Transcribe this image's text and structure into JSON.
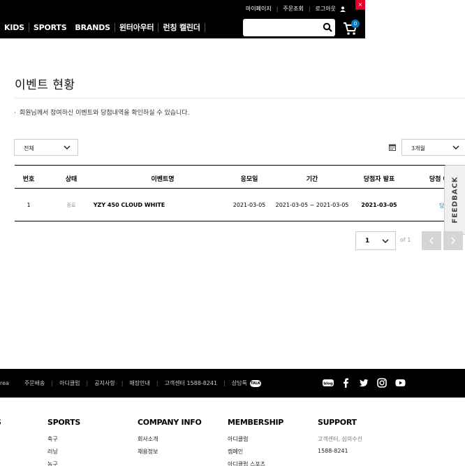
{
  "header": {
    "utility": [
      "마이페이지",
      "주문조회",
      "로그아웃"
    ],
    "close_badge": "×",
    "nav": [
      {
        "label": "KIDS"
      },
      {
        "label": "SPORTS"
      },
      {
        "label": "BRANDS"
      },
      {
        "label": "윈터아우터"
      },
      {
        "label": "런칭 캘린더"
      }
    ],
    "cart_count": "0"
  },
  "main": {
    "title": "이벤트 현황",
    "notice": "회원님께서 참여하신 이벤트와 당첨내역을 확인하실 수 있습니다.",
    "filter_type": "전체",
    "filter_period": "3개월",
    "table": {
      "headers": [
        "번호",
        "상태",
        "이벤트명",
        "응모일",
        "기간",
        "당첨자 발표",
        "당첨 여부"
      ],
      "rows": [
        {
          "no": "1",
          "status": "종료",
          "name": "YZY 450 CLOUD WHITE",
          "applied": "2021-03-05",
          "period": "2021-03-05 ~ 2021-03-05",
          "announce": "2021-03-05",
          "result": "당첨(클릭)"
        }
      ]
    },
    "pager": {
      "current": "1",
      "of_label": "of 1"
    },
    "feedback_label": "FEEDBACK"
  },
  "footer": {
    "links": [
      "rea",
      "주문배송",
      "아디클럽",
      "공지사항",
      "매장안내",
      "고객센터 1588-8241",
      "상담톡"
    ],
    "talk_badge": "TALK",
    "social_icons": [
      "blog-icon",
      "facebook-icon",
      "twitter-icon",
      "instagram-icon",
      "youtube-icon"
    ],
    "columns": [
      {
        "title": "S",
        "items": []
      },
      {
        "title": "SPORTS",
        "items": [
          "축구",
          "러닝",
          "농구"
        ]
      },
      {
        "title": "COMPANY INFO",
        "items": [
          "회사소개",
          "채용정보"
        ]
      },
      {
        "title": "MEMBERSHIP",
        "items": [
          "아디클럽",
          "캠페인",
          "아디클럽 스포츠"
        ]
      },
      {
        "title": "SUPPORT",
        "items": [
          "고객센터, 심의수선",
          "1588-8241"
        ]
      }
    ]
  },
  "colors": {
    "accent_blue": "#0b7bc1",
    "header_bg": "#000000",
    "close_red": "#e4002b"
  }
}
